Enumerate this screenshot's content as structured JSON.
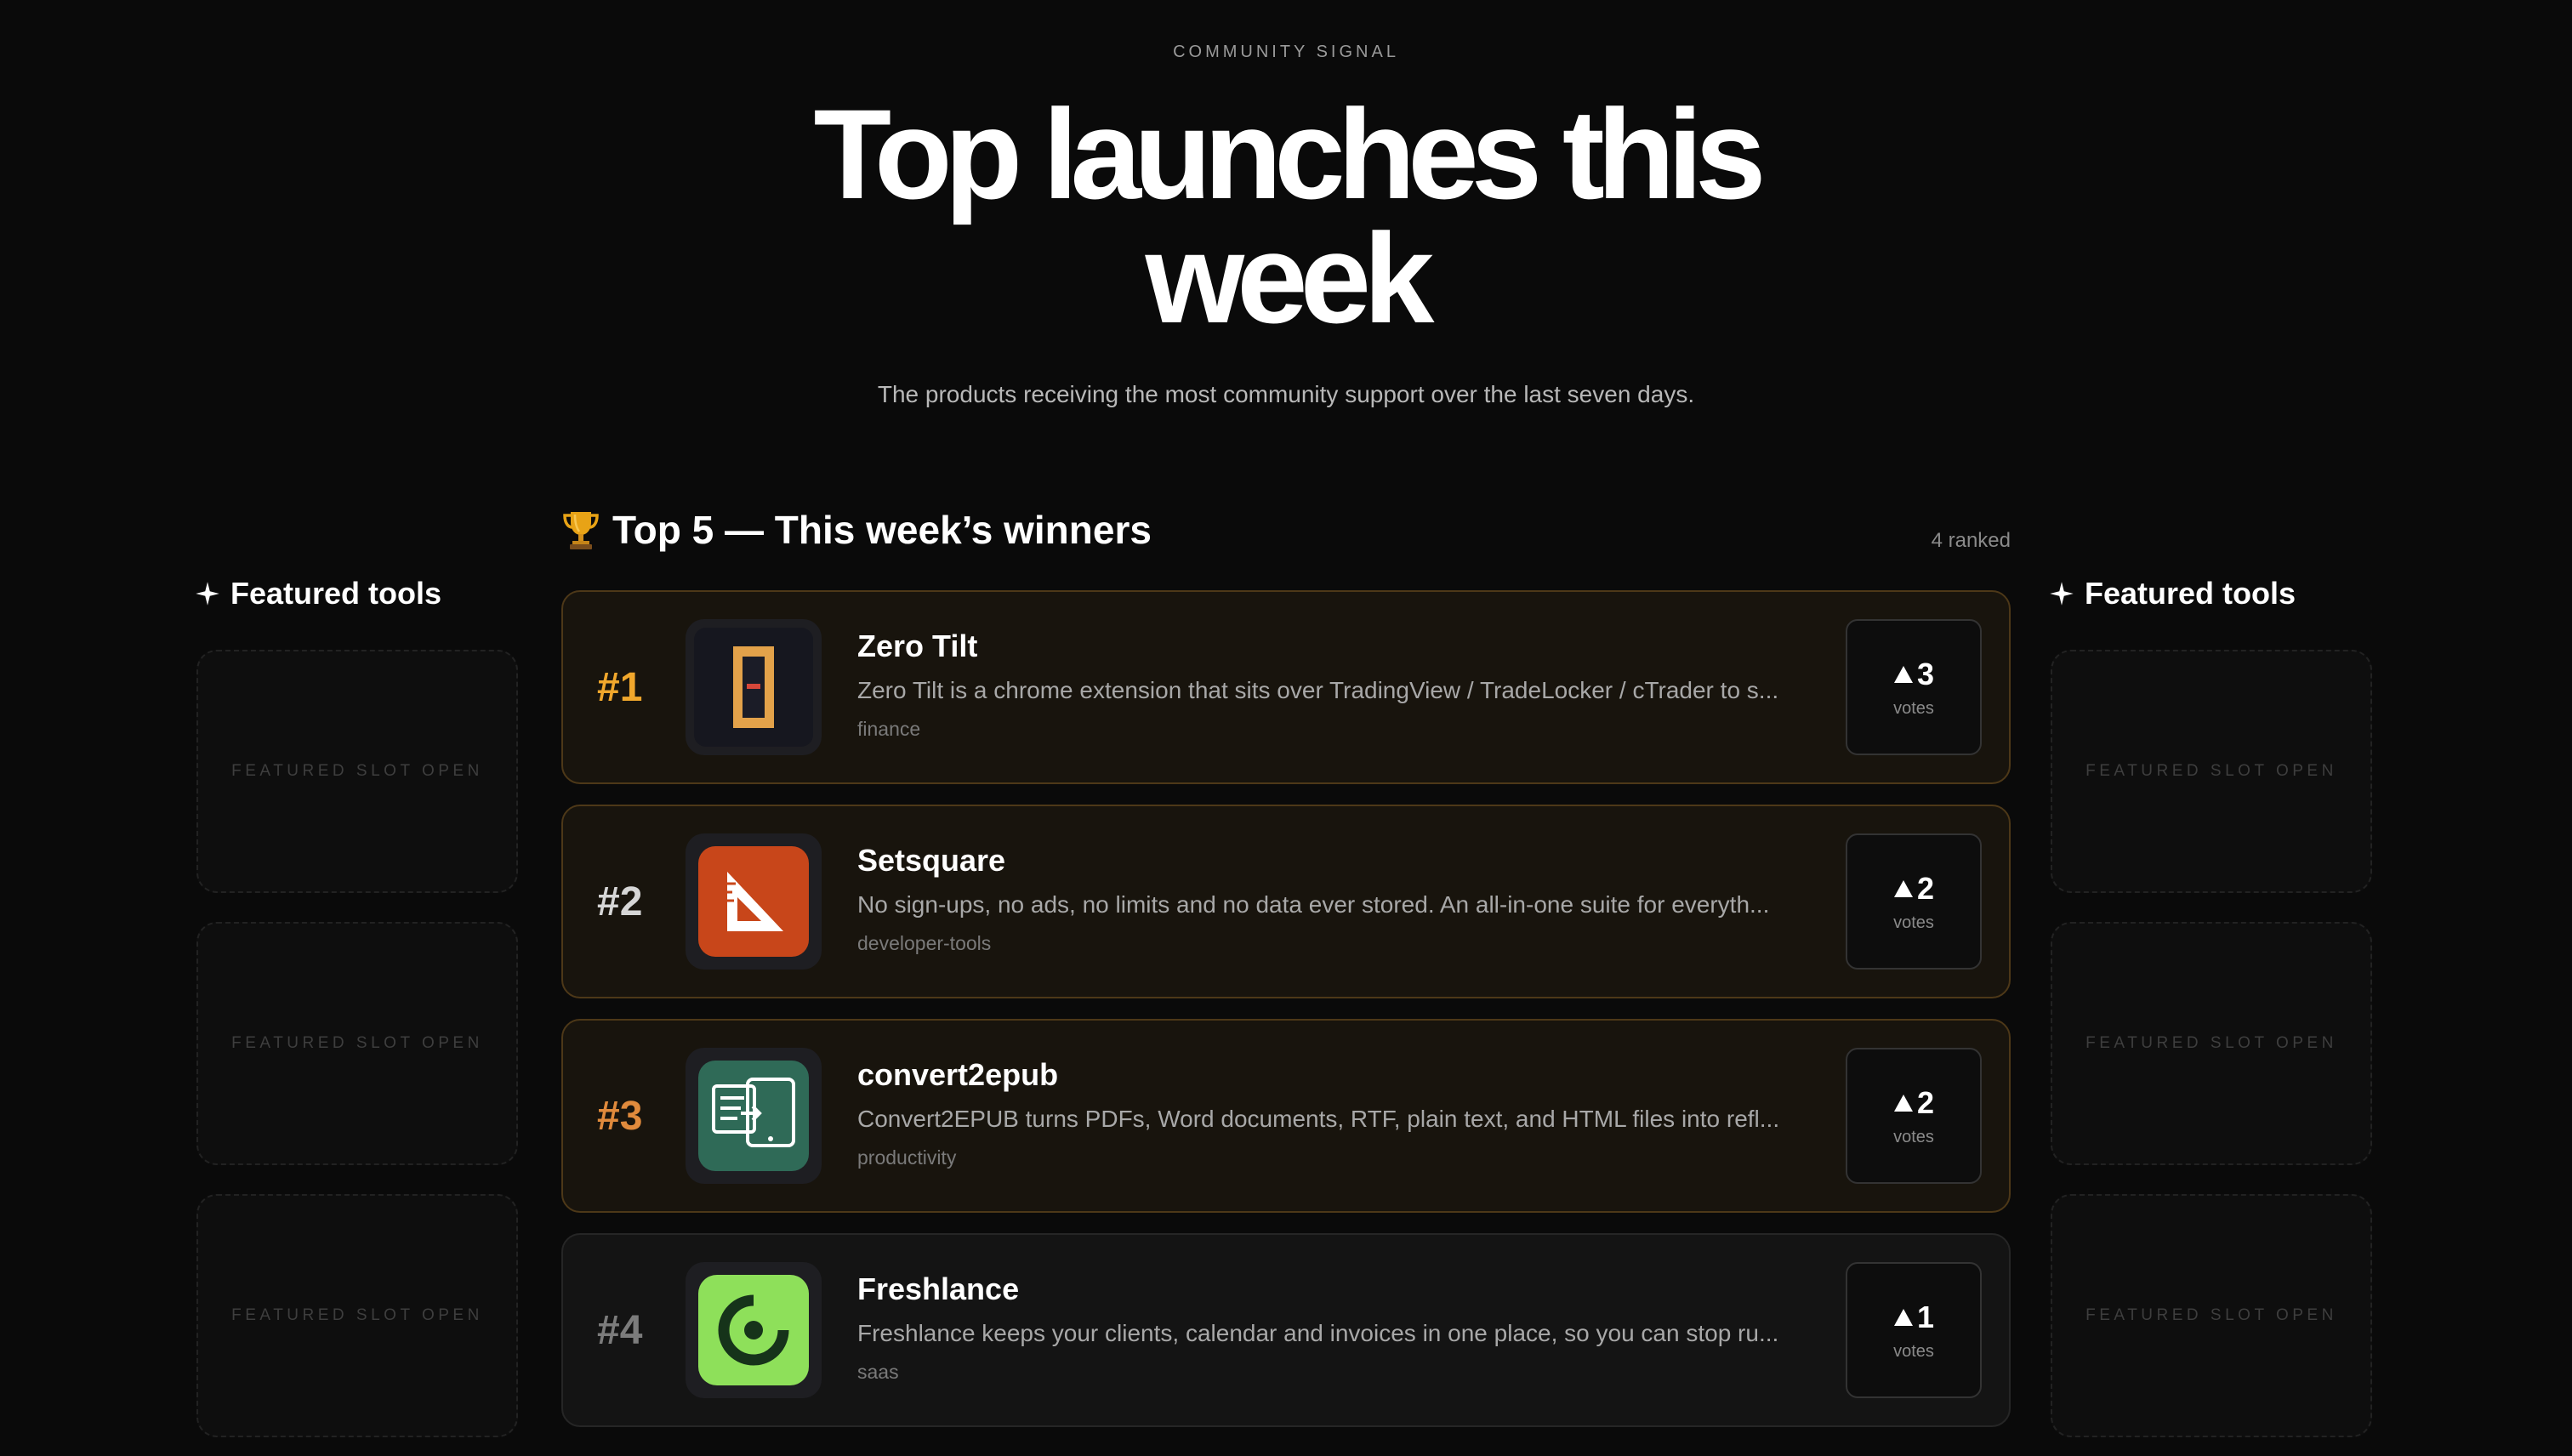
{
  "header": {
    "eyebrow": "COMMUNITY SIGNAL",
    "title_line1": "Top launches this",
    "title_line2": "week",
    "subtitle": "The products receiving the most community support over the last seven days."
  },
  "leaderboard": {
    "title": "Top 5 — This week’s winners",
    "trophy_icon": "trophy-icon",
    "ranked_count": "4 ranked",
    "vote_icon": "upvote-triangle-icon",
    "items": [
      {
        "rank": "#1",
        "name": "Zero Tilt",
        "description": "Zero Tilt is a chrome extension that sits over TradingView / TradeLocker / cTrader to s...",
        "tag": "finance",
        "votes": "3",
        "votes_label": "votes",
        "rank_color": "#f0a72c"
      },
      {
        "rank": "#2",
        "name": "Setsquare",
        "description": "No sign-ups, no ads, no limits and no data ever stored. An all-in-one suite for everyth...",
        "tag": "developer-tools",
        "votes": "2",
        "votes_label": "votes",
        "rank_color": "#d6d6d6"
      },
      {
        "rank": "#3",
        "name": "convert2epub",
        "description": "Convert2EPUB turns PDFs, Word documents, RTF, plain text, and HTML files into refl...",
        "tag": "productivity",
        "votes": "2",
        "votes_label": "votes",
        "rank_color": "#e08a3c"
      },
      {
        "rank": "#4",
        "name": "Freshlance",
        "description": "Freshlance keeps your clients, calendar and invoices in one place, so you can stop ru...",
        "tag": "saas",
        "votes": "1",
        "votes_label": "votes",
        "rank_color": "#7c7c7c"
      }
    ]
  },
  "featured": {
    "title": "Featured tools",
    "star_icon": "sparkle-star-icon",
    "slot_label": "FEATURED SLOT OPEN"
  },
  "colors": {
    "background": "#0a0a0a",
    "gold_card_bg": "#18140d",
    "gold_card_border": "#4d3818",
    "accent_gold": "#f0a72c"
  }
}
